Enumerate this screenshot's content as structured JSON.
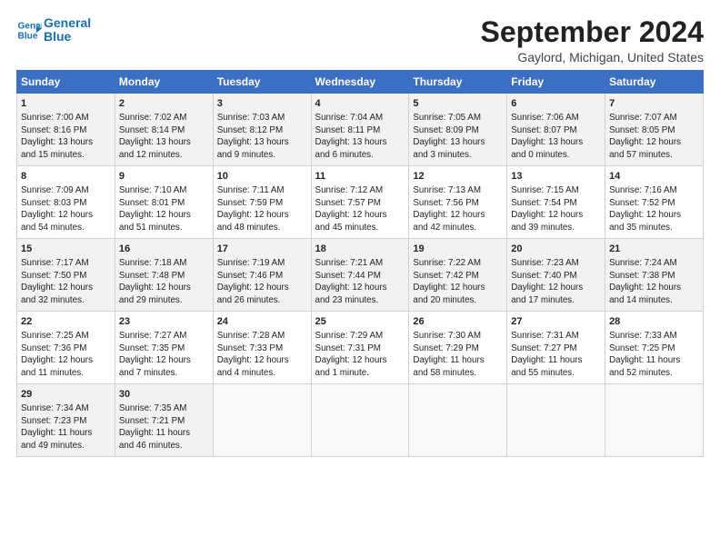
{
  "logo": {
    "line1": "General",
    "line2": "Blue"
  },
  "title": "September 2024",
  "subtitle": "Gaylord, Michigan, United States",
  "days_of_week": [
    "Sunday",
    "Monday",
    "Tuesday",
    "Wednesday",
    "Thursday",
    "Friday",
    "Saturday"
  ],
  "weeks": [
    [
      {
        "day": "1",
        "info": "Sunrise: 7:00 AM\nSunset: 8:16 PM\nDaylight: 13 hours\nand 15 minutes."
      },
      {
        "day": "2",
        "info": "Sunrise: 7:02 AM\nSunset: 8:14 PM\nDaylight: 13 hours\nand 12 minutes."
      },
      {
        "day": "3",
        "info": "Sunrise: 7:03 AM\nSunset: 8:12 PM\nDaylight: 13 hours\nand 9 minutes."
      },
      {
        "day": "4",
        "info": "Sunrise: 7:04 AM\nSunset: 8:11 PM\nDaylight: 13 hours\nand 6 minutes."
      },
      {
        "day": "5",
        "info": "Sunrise: 7:05 AM\nSunset: 8:09 PM\nDaylight: 13 hours\nand 3 minutes."
      },
      {
        "day": "6",
        "info": "Sunrise: 7:06 AM\nSunset: 8:07 PM\nDaylight: 13 hours\nand 0 minutes."
      },
      {
        "day": "7",
        "info": "Sunrise: 7:07 AM\nSunset: 8:05 PM\nDaylight: 12 hours\nand 57 minutes."
      }
    ],
    [
      {
        "day": "8",
        "info": "Sunrise: 7:09 AM\nSunset: 8:03 PM\nDaylight: 12 hours\nand 54 minutes."
      },
      {
        "day": "9",
        "info": "Sunrise: 7:10 AM\nSunset: 8:01 PM\nDaylight: 12 hours\nand 51 minutes."
      },
      {
        "day": "10",
        "info": "Sunrise: 7:11 AM\nSunset: 7:59 PM\nDaylight: 12 hours\nand 48 minutes."
      },
      {
        "day": "11",
        "info": "Sunrise: 7:12 AM\nSunset: 7:57 PM\nDaylight: 12 hours\nand 45 minutes."
      },
      {
        "day": "12",
        "info": "Sunrise: 7:13 AM\nSunset: 7:56 PM\nDaylight: 12 hours\nand 42 minutes."
      },
      {
        "day": "13",
        "info": "Sunrise: 7:15 AM\nSunset: 7:54 PM\nDaylight: 12 hours\nand 39 minutes."
      },
      {
        "day": "14",
        "info": "Sunrise: 7:16 AM\nSunset: 7:52 PM\nDaylight: 12 hours\nand 35 minutes."
      }
    ],
    [
      {
        "day": "15",
        "info": "Sunrise: 7:17 AM\nSunset: 7:50 PM\nDaylight: 12 hours\nand 32 minutes."
      },
      {
        "day": "16",
        "info": "Sunrise: 7:18 AM\nSunset: 7:48 PM\nDaylight: 12 hours\nand 29 minutes."
      },
      {
        "day": "17",
        "info": "Sunrise: 7:19 AM\nSunset: 7:46 PM\nDaylight: 12 hours\nand 26 minutes."
      },
      {
        "day": "18",
        "info": "Sunrise: 7:21 AM\nSunset: 7:44 PM\nDaylight: 12 hours\nand 23 minutes."
      },
      {
        "day": "19",
        "info": "Sunrise: 7:22 AM\nSunset: 7:42 PM\nDaylight: 12 hours\nand 20 minutes."
      },
      {
        "day": "20",
        "info": "Sunrise: 7:23 AM\nSunset: 7:40 PM\nDaylight: 12 hours\nand 17 minutes."
      },
      {
        "day": "21",
        "info": "Sunrise: 7:24 AM\nSunset: 7:38 PM\nDaylight: 12 hours\nand 14 minutes."
      }
    ],
    [
      {
        "day": "22",
        "info": "Sunrise: 7:25 AM\nSunset: 7:36 PM\nDaylight: 12 hours\nand 11 minutes."
      },
      {
        "day": "23",
        "info": "Sunrise: 7:27 AM\nSunset: 7:35 PM\nDaylight: 12 hours\nand 7 minutes."
      },
      {
        "day": "24",
        "info": "Sunrise: 7:28 AM\nSunset: 7:33 PM\nDaylight: 12 hours\nand 4 minutes."
      },
      {
        "day": "25",
        "info": "Sunrise: 7:29 AM\nSunset: 7:31 PM\nDaylight: 12 hours\nand 1 minute."
      },
      {
        "day": "26",
        "info": "Sunrise: 7:30 AM\nSunset: 7:29 PM\nDaylight: 11 hours\nand 58 minutes."
      },
      {
        "day": "27",
        "info": "Sunrise: 7:31 AM\nSunset: 7:27 PM\nDaylight: 11 hours\nand 55 minutes."
      },
      {
        "day": "28",
        "info": "Sunrise: 7:33 AM\nSunset: 7:25 PM\nDaylight: 11 hours\nand 52 minutes."
      }
    ],
    [
      {
        "day": "29",
        "info": "Sunrise: 7:34 AM\nSunset: 7:23 PM\nDaylight: 11 hours\nand 49 minutes."
      },
      {
        "day": "30",
        "info": "Sunrise: 7:35 AM\nSunset: 7:21 PM\nDaylight: 11 hours\nand 46 minutes."
      },
      {
        "day": "",
        "info": ""
      },
      {
        "day": "",
        "info": ""
      },
      {
        "day": "",
        "info": ""
      },
      {
        "day": "",
        "info": ""
      },
      {
        "day": "",
        "info": ""
      }
    ]
  ]
}
